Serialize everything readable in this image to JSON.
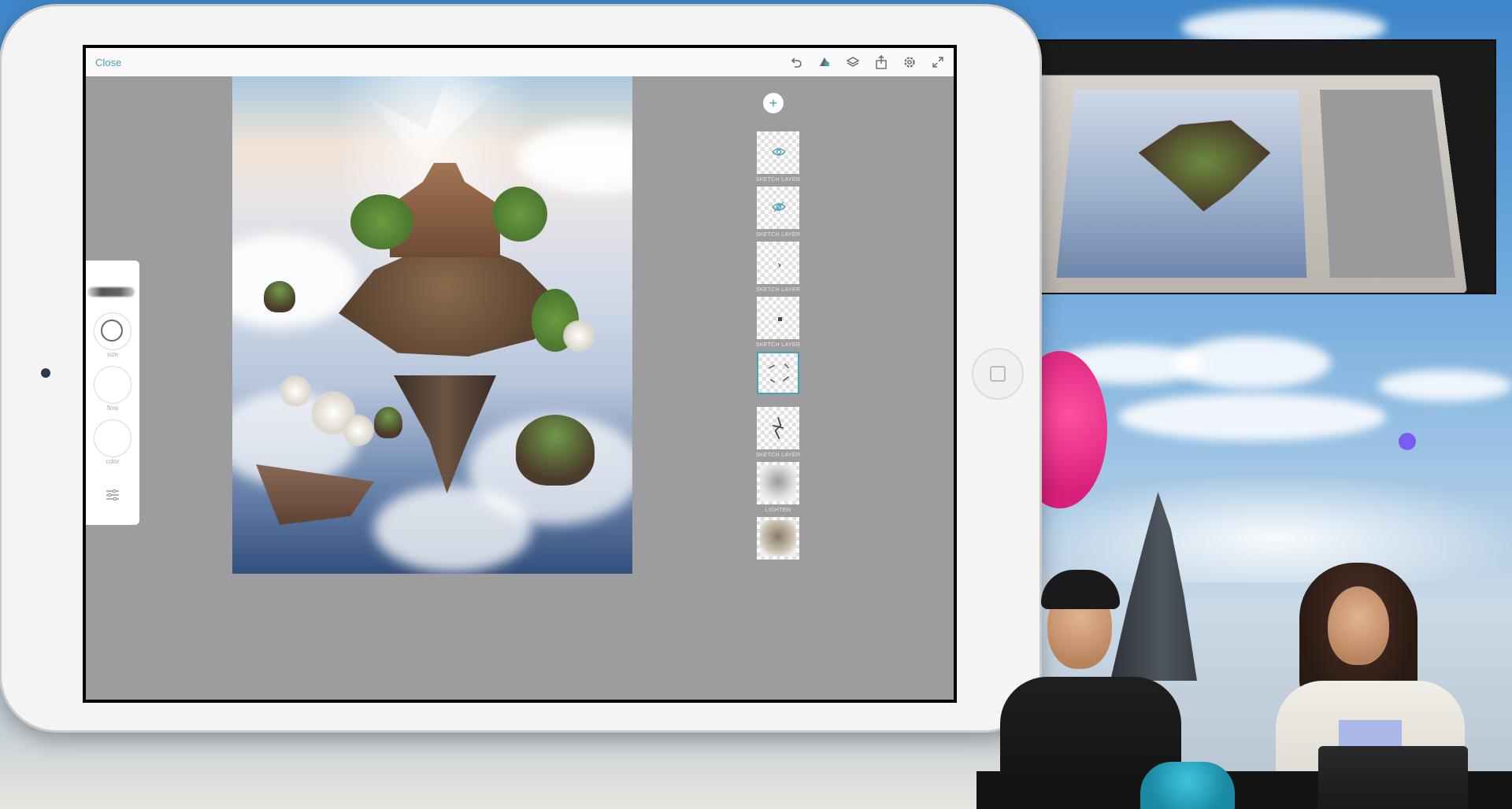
{
  "app": {
    "close_label": "Close",
    "toolbar": {
      "icons": [
        "undo-icon",
        "fill-icon",
        "layers-icon",
        "share-icon",
        "settings-icon",
        "fullscreen-icon"
      ]
    }
  },
  "brush_panel": {
    "size_label": "size",
    "flow_label": "flow",
    "color_label": "color"
  },
  "layers": {
    "add_symbol": "+",
    "items": [
      {
        "label": "SKETCH LAYER",
        "hidden": true
      },
      {
        "label": "SKETCH LAYER",
        "hidden": true
      },
      {
        "label": "SKETCH LAYER",
        "hidden": false
      },
      {
        "label": "SKETCH LAYER",
        "hidden": false
      },
      {
        "label": "",
        "hidden": false,
        "selected": true
      },
      {
        "label": "SKETCH LAYER",
        "hidden": false
      },
      {
        "label": "LIGHTEN",
        "hidden": false
      },
      {
        "label": "",
        "hidden": false
      }
    ]
  },
  "colors": {
    "accent": "#4a9db8",
    "selected_layer": "#3fa5b8",
    "workspace_gray": "#9d9d9f"
  }
}
